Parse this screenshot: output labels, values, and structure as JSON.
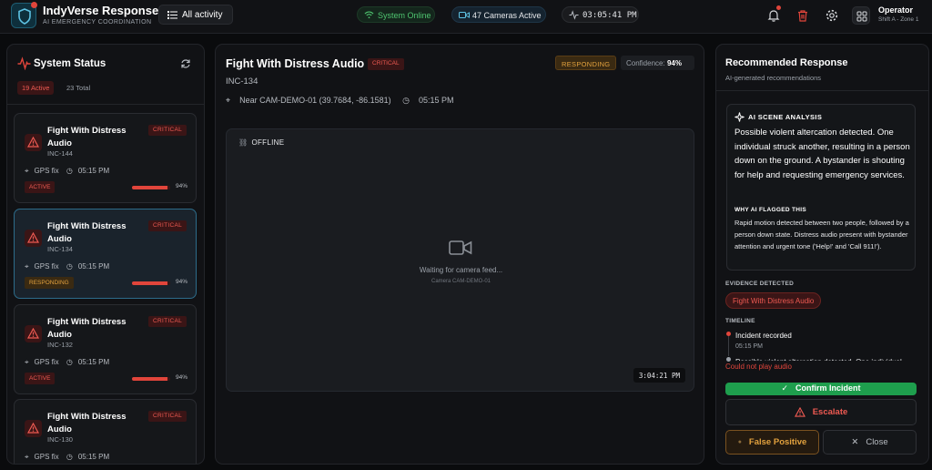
{
  "header": {
    "app_name": "IndyVerse Response",
    "app_subtitle": "AI EMERGENCY COORDINATION",
    "all_activity": "All activity",
    "system_status": "System Online",
    "cameras_active": "47 Cameras Active",
    "clock": "03:05:41 PM",
    "operator_name": "Operator",
    "operator_shift": "Shift A - Zone 1"
  },
  "left": {
    "title": "System Status",
    "active_badge": "19 Active",
    "total_label": "23 Total",
    "cards": [
      {
        "title": "Fight With Distress Audio",
        "id": "INC-144",
        "severity": "CRITICAL",
        "gps": "GPS fix",
        "time": "05:15 PM",
        "status": "ACTIVE",
        "confidence": 94,
        "confidence_label": "94%"
      },
      {
        "title": "Fight With Distress Audio",
        "id": "INC-134",
        "severity": "CRITICAL",
        "gps": "GPS fix",
        "time": "05:15 PM",
        "status": "RESPONDING",
        "confidence": 94,
        "confidence_label": "94%"
      },
      {
        "title": "Fight With Distress Audio",
        "id": "INC-132",
        "severity": "CRITICAL",
        "gps": "GPS fix",
        "time": "05:15 PM",
        "status": "ACTIVE",
        "confidence": 94,
        "confidence_label": "94%"
      },
      {
        "title": "Fight With Distress Audio",
        "id": "INC-130",
        "severity": "CRITICAL",
        "gps": "GPS fix",
        "time": "05:15 PM"
      }
    ]
  },
  "detail": {
    "title": "Fight With Distress Audio",
    "severity": "CRITICAL",
    "status": "RESPONDING",
    "confidence_label": "Confidence:",
    "confidence_value": "94%",
    "incident_id": "INC-134",
    "location": "Near CAM-DEMO-01 (39.7684, -86.1581)",
    "time": "05:15 PM",
    "feed_state": "OFFLINE",
    "waiting_text": "Waiting for camera feed...",
    "camera_label": "Camera CAM-DEMO-01",
    "feed_time": "3:04:21 PM"
  },
  "recommend": {
    "title": "Recommended Response",
    "subtitle": "AI-generated recommendations",
    "scene_heading": "AI SCENE ANALYSIS",
    "scene_text": "Possible violent altercation detected. One individual struck another, resulting in a person down on the ground. A bystander is shouting for help and requesting emergency services.",
    "why_heading": "WHY AI FLAGGED THIS",
    "why_text": "Rapid motion detected between two people, followed by a person down state. Distress audio present with bystander attention and urgent tone ('Help!' and 'Call 911!').",
    "evidence_heading": "EVIDENCE DETECTED",
    "evidence_chip": "Fight With Distress Audio",
    "timeline_heading": "TIMELINE",
    "timeline_event_1": "Incident recorded",
    "timeline_time_1": "05:15 PM",
    "timeline_event_2": "Possible violent altercation detected. One individual",
    "audio_error": "Could not play audio",
    "confirm": "Confirm Incident",
    "escalate": "Escalate",
    "false_positive": "False Positive",
    "close": "Close"
  },
  "colors": {
    "critical": "#e1453b",
    "responding": "#e3a23e",
    "online": "#4ec46f",
    "confirm": "#1e9e4d",
    "accent": "#2d6c8a"
  }
}
